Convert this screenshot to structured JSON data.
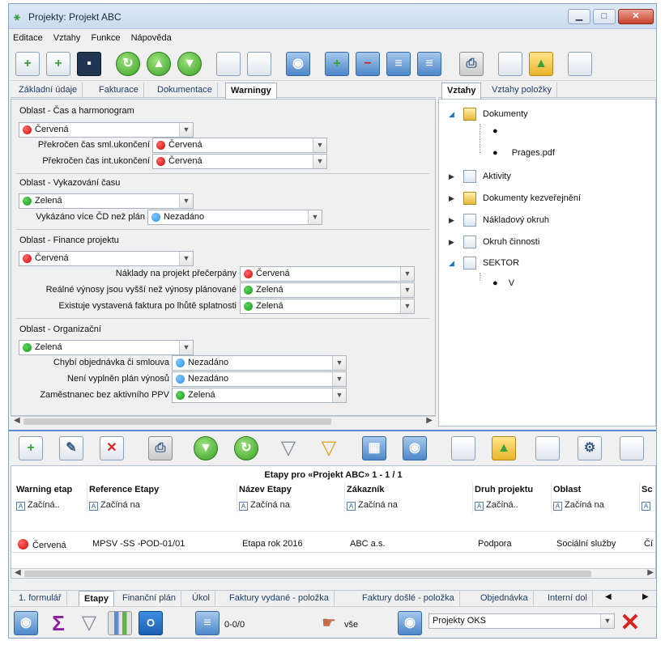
{
  "window": {
    "title": "Projekty: Projekt ABC",
    "minimize_label": "▁",
    "maximize_label": "□",
    "close_label": "✕"
  },
  "menu": [
    "Editace",
    "Vztahy",
    "Funkce",
    "Nápověda"
  ],
  "left_tabs": [
    "Základní údaje",
    "Fakturace",
    "Dokumentace",
    "Warningy"
  ],
  "left_active_tab": "Warningy",
  "right_tabs": [
    "Vztahy",
    "Vztahy položky"
  ],
  "right_active_tab": "Vztahy",
  "warnings": {
    "cas": {
      "title": "Oblast - Čas a harmonogram",
      "value": "Červená",
      "color": "red",
      "fields": [
        {
          "label": "Překročen čas sml.ukončení",
          "value": "Červená",
          "color": "red"
        },
        {
          "label": "Překročen čas int.ukončení",
          "value": "Červená",
          "color": "red"
        }
      ]
    },
    "vykazovani": {
      "title": "Oblast - Vykazování času",
      "value": "Zelená",
      "color": "green",
      "fields": [
        {
          "label": "Vykázáno více ČD než plán",
          "value": "Nezadáno",
          "color": "blue"
        }
      ]
    },
    "finance": {
      "title": "Oblast - Finance projektu",
      "value": "Červená",
      "color": "red",
      "fields": [
        {
          "label": "Náklady na projekt přečerpány",
          "value": "Červená",
          "color": "red"
        },
        {
          "label": "Reálné výnosy jsou vyšší než výnosy plánované",
          "value": "Zelená",
          "color": "green"
        },
        {
          "label": "Existuje vystavená faktura po lhůtě splatnosti",
          "value": "Zelená",
          "color": "green"
        }
      ]
    },
    "organizacni": {
      "title": "Oblast - Organizační",
      "value": "Zelená",
      "color": "green",
      "fields": [
        {
          "label": "Chybí objednávka či smlouva",
          "value": "Nezadáno",
          "color": "blue"
        },
        {
          "label": "Není vyplněn plán výnosů",
          "value": "Nezadáno",
          "color": "blue"
        },
        {
          "label": "Zaměstnanec bez aktivního PPV",
          "value": "Zelená",
          "color": "green"
        }
      ]
    }
  },
  "tree": {
    "dokumenty": "Dokumenty",
    "dokumenty_children": [
      "",
      "Prages.pdf"
    ],
    "aktivity": "Aktivity",
    "dokumenty_kz": "Dokumenty kezveřejnění",
    "nakladovy": "Nákladový okruh",
    "okruh": "Okruh činnosti",
    "sektor": "SEKTOR",
    "sektor_children": [
      "V"
    ]
  },
  "grid": {
    "caption": "Etapy pro «Projekt ABC»  1 - 1 / 1",
    "columns": [
      "Warning etap",
      "Reference Etapy",
      "Název Etapy",
      "Zákazník",
      "Druh projektu",
      "Oblast",
      "Sc"
    ],
    "filters": [
      "Začíná..",
      "Začíná na",
      "Začíná na",
      "Začíná na",
      "Začíná..",
      "Začíná na",
      ""
    ],
    "row": [
      "Červená",
      "MPSV -SS -POD-01/01",
      "Etapa rok 2016",
      "ABC a.s.",
      "Podpora",
      "Sociální služby",
      "Čí"
    ]
  },
  "bottom_tabs": [
    "1. formulář",
    "Etapy",
    "Finanční plán",
    "Úkol",
    "Faktury vydané - položka",
    "Faktury došlé - položka",
    "Objednávka",
    "Interní dol"
  ],
  "bottom_active_tab": "Etapy",
  "status": {
    "count": "0-0/0",
    "filter_label": "vše",
    "combo_value": "Projekty OKS"
  },
  "colors": {
    "accent": "#5a8ad0",
    "red": "#d40000",
    "green": "#169a16",
    "blue": "#2a8fe8"
  }
}
